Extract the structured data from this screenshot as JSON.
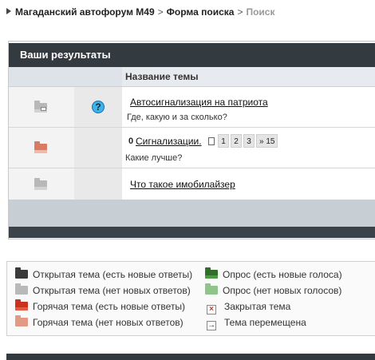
{
  "breadcrumb": {
    "forum": "Магаданский автофорум М49",
    "sep1": ">",
    "search_form": "Форма поиска",
    "sep2": ">",
    "current": "Поиск"
  },
  "results": {
    "title": "Ваши результаты",
    "column_topic": "Название темы",
    "rows": [
      {
        "title": "Автосигнализация на патриота",
        "subtitle": "Где, какую и за сколько?",
        "icon": "topic-read-icon",
        "has_question": true
      },
      {
        "title": "Сигнализации.",
        "subtitle": "Какие лучше?",
        "icon": "hot-topic-read-icon",
        "attachment": "0",
        "pages": [
          "1",
          "2",
          "3",
          "» 15"
        ]
      },
      {
        "title": "Что такое имобилайзер",
        "icon": "topic-read-icon"
      }
    ],
    "question_mark": "?"
  },
  "legend": {
    "open_new": "Открытая тема (есть новые ответы)",
    "open_nonew": "Открытая тема (нет новых ответов)",
    "hot_new": "Горячая тема (есть новые ответы)",
    "hot_nonew": "Горячая тема (нет новых ответов)",
    "poll_new": "Опрос (есть новые голоса)",
    "poll_nonew": "Опрос (нет новых голосов)",
    "closed": "Закрытая тема",
    "moved": "Тема перемещена",
    "closed_glyph": "×",
    "moved_glyph": "→"
  }
}
